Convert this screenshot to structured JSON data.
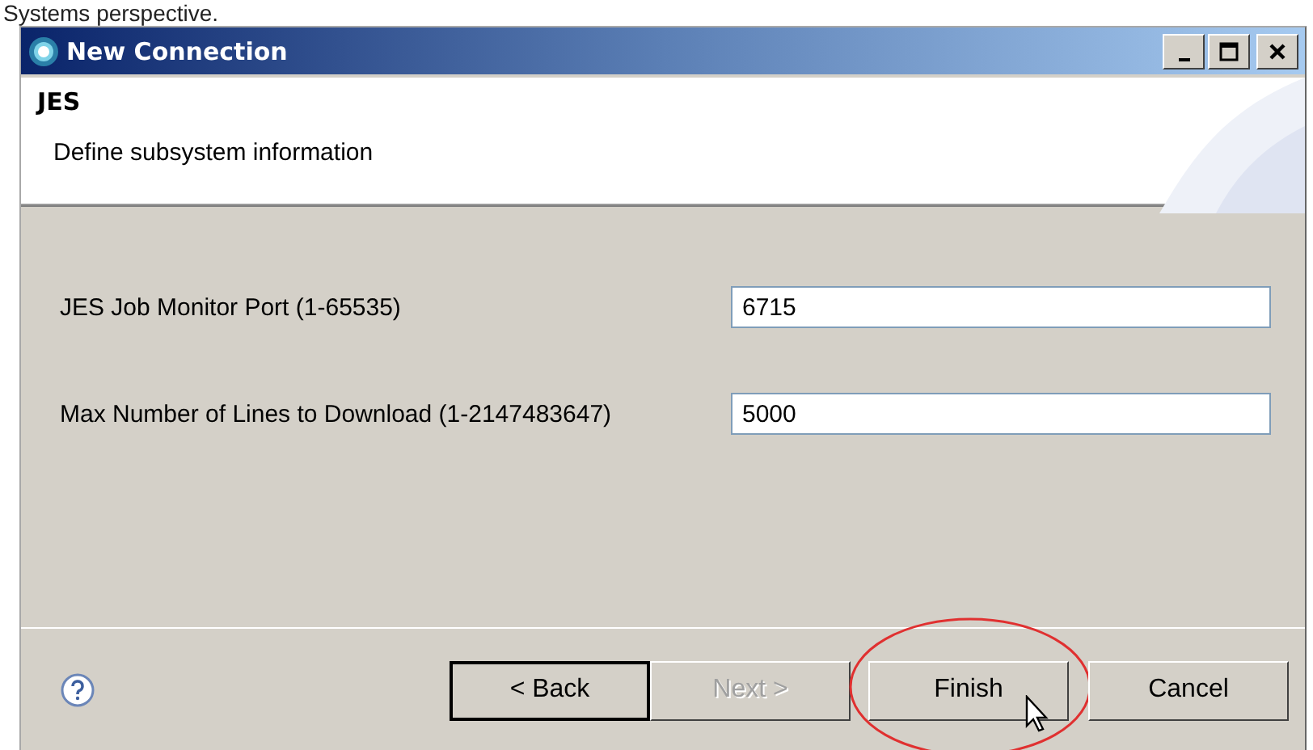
{
  "caption": "Systems perspective.",
  "window": {
    "title": "New Connection"
  },
  "header": {
    "title": "JES",
    "description": "Define subsystem information"
  },
  "fields": [
    {
      "label": "JES Job Monitor Port (1-65535)",
      "value": "6715"
    },
    {
      "label": "Max Number of Lines to Download (1-2147483647)",
      "value": "5000"
    }
  ],
  "buttons": [
    {
      "label": "< Back",
      "disabled": false,
      "focused": true,
      "circled": false
    },
    {
      "label": "Next >",
      "disabled": true,
      "focused": false,
      "circled": false
    },
    {
      "label": "Finish",
      "disabled": false,
      "focused": false,
      "circled": true
    },
    {
      "label": "Cancel",
      "disabled": false,
      "focused": false,
      "circled": false
    }
  ]
}
